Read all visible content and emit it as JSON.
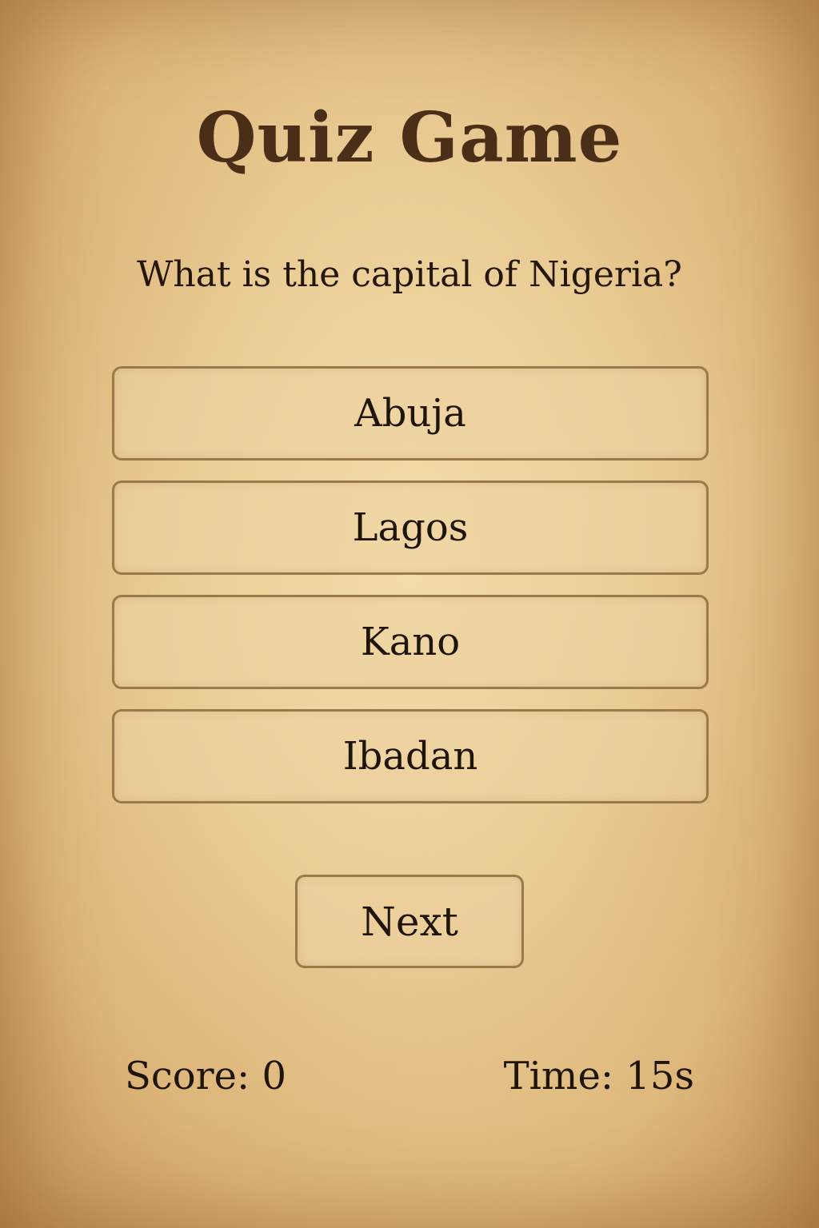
{
  "game": {
    "title": "Quiz Game"
  },
  "question": {
    "text": "What is the capital of Nigeria?"
  },
  "options": [
    {
      "label": "Abuja"
    },
    {
      "label": "Lagos"
    },
    {
      "label": "Kano"
    },
    {
      "label": "Ibadan"
    }
  ],
  "controls": {
    "next_label": "Next"
  },
  "status": {
    "score_text": "Score: 0",
    "time_text": "Time: 15s"
  },
  "colors": {
    "background": "#e8c995",
    "title": "#4a2e18",
    "text": "#1e1408",
    "button_border": "#9a7a48"
  }
}
